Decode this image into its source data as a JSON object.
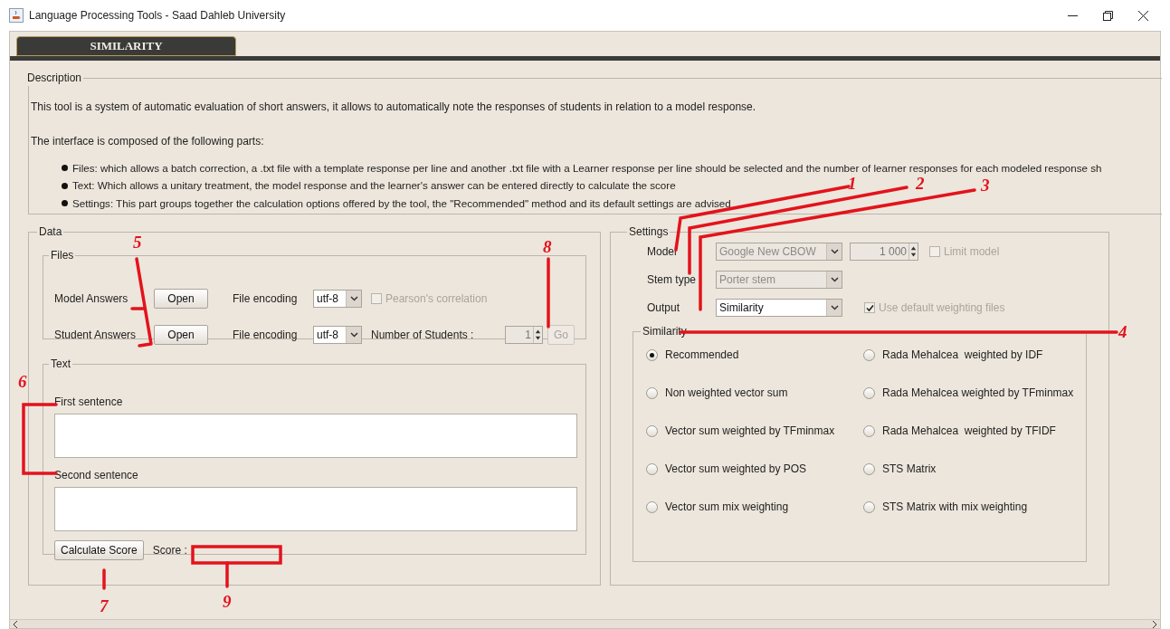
{
  "window": {
    "title": "Language Processing Tools - Saad Dahleb University"
  },
  "tabs": [
    {
      "label": "SIMILARITY",
      "selected": true
    }
  ],
  "description": {
    "legend": "Description",
    "paragraphs": [
      "This tool is a system of automatic evaluation of short answers, it allows to automatically note the responses of students in relation to a model response.",
      "The interface is composed of the following parts:"
    ],
    "bullets": [
      "Files: which allows a batch correction, a .txt file with a template response per line and another .txt file with a Learner response per line should be selected and the number of learner responses for each modeled response sh",
      "Text: Which allows a unitary treatment, the model response and the learner's answer can be entered directly to calculate the score",
      "Settings: This part groups together the calculation options offered by the tool, the \"Recommended\" method and its default settings are advised"
    ]
  },
  "data": {
    "legend": "Data",
    "files": {
      "legend": "Files",
      "rows": [
        {
          "kind": "pearson",
          "label": "Model Answers",
          "button": "Open",
          "encoding_label": "File encoding",
          "encoding": "utf-8",
          "checkbox": {
            "label": "Pearson's correlation",
            "checked": false,
            "disabled": true
          }
        },
        {
          "kind": "students",
          "label": "Student Answers",
          "button": "Open",
          "encoding_label": "File encoding",
          "encoding": "utf-8",
          "count_label": "Number of Students :",
          "count": "1",
          "go": {
            "label": "Go",
            "disabled": true
          }
        }
      ]
    },
    "text": {
      "legend": "Text",
      "fields": [
        {
          "label": "First sentence"
        },
        {
          "label": "Second sentence"
        }
      ],
      "calculate_button": "Calculate Score",
      "score_label": "Score :"
    }
  },
  "settings": {
    "legend": "Settings",
    "rows": [
      {
        "label": "Model",
        "combo": {
          "value": "Google New CBOW",
          "disabled": true
        },
        "spinner": {
          "value": "1 000",
          "disabled": true
        },
        "checkbox": {
          "label": "Limit model",
          "checked": false,
          "disabled": true
        }
      },
      {
        "label": "Stem type",
        "combo": {
          "value": "Porter stem",
          "disabled": true
        }
      },
      {
        "label": "Output",
        "combo": {
          "value": "Similarity",
          "disabled": false
        },
        "checkbox": {
          "label": "Use default weighting files",
          "checked": true,
          "disabled": true
        }
      }
    ],
    "similarity": {
      "legend": "Similarity",
      "columns": [
        [
          {
            "label": "Recommended",
            "selected": true
          },
          {
            "label": "Non weighted vector sum",
            "selected": false
          },
          {
            "label": "Vector sum weighted by TFminmax",
            "selected": false
          },
          {
            "label": "Vector sum weighted by POS",
            "selected": false
          },
          {
            "label": "Vector sum mix weighting",
            "selected": false
          }
        ],
        [
          {
            "label": "Rada Mehalcea  weighted by IDF",
            "selected": false
          },
          {
            "label": "Rada Mehalcea weighted by TFminmax",
            "selected": false
          },
          {
            "label": "Rada Mehalcea  weighted by TFIDF",
            "selected": false
          },
          {
            "label": "STS Matrix",
            "selected": false
          },
          {
            "label": "STS Matrix with mix weighting",
            "selected": false
          }
        ]
      ]
    }
  },
  "annotations": [
    {
      "label": "1"
    },
    {
      "label": "2"
    },
    {
      "label": "3"
    },
    {
      "label": "4"
    },
    {
      "label": "5"
    },
    {
      "label": "6"
    },
    {
      "label": "7"
    },
    {
      "label": "8"
    },
    {
      "label": "9"
    }
  ]
}
